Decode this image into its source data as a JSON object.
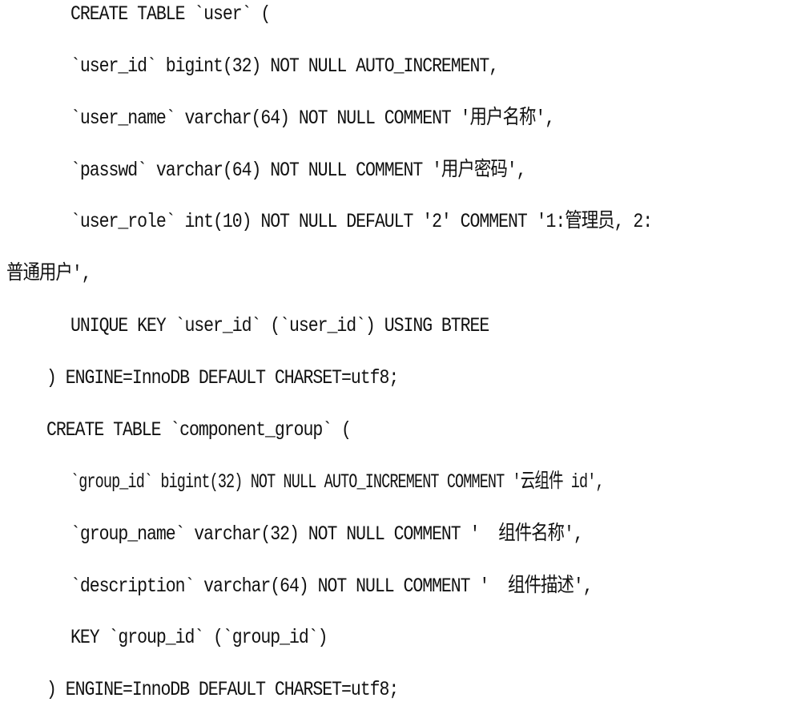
{
  "document": {
    "language": "SQL",
    "lines": [
      "CREATE TABLE `user` (",
      "`user_id` bigint(32) NOT NULL AUTO_INCREMENT,",
      "`user_name` varchar(64) NOT NULL COMMENT '用户名称',",
      "`passwd` varchar(64) NOT NULL COMMENT '用户密码',",
      "`user_role` int(10) NOT NULL DEFAULT '2' COMMENT '1:管理员, 2:",
      "普通用户',",
      "UNIQUE KEY `user_id` (`user_id`) USING BTREE",
      ") ENGINE=InnoDB DEFAULT CHARSET=utf8;",
      "CREATE TABLE `component_group` (",
      "`group_id` bigint(32) NOT NULL AUTO_INCREMENT COMMENT '云组件 id',",
      "`group_name` varchar(32) NOT NULL COMMENT '  组件名称',",
      "`description` varchar(64) NOT NULL COMMENT '  组件描述',",
      "KEY `group_id` (`group_id`)",
      ") ENGINE=InnoDB DEFAULT CHARSET=utf8;"
    ]
  }
}
